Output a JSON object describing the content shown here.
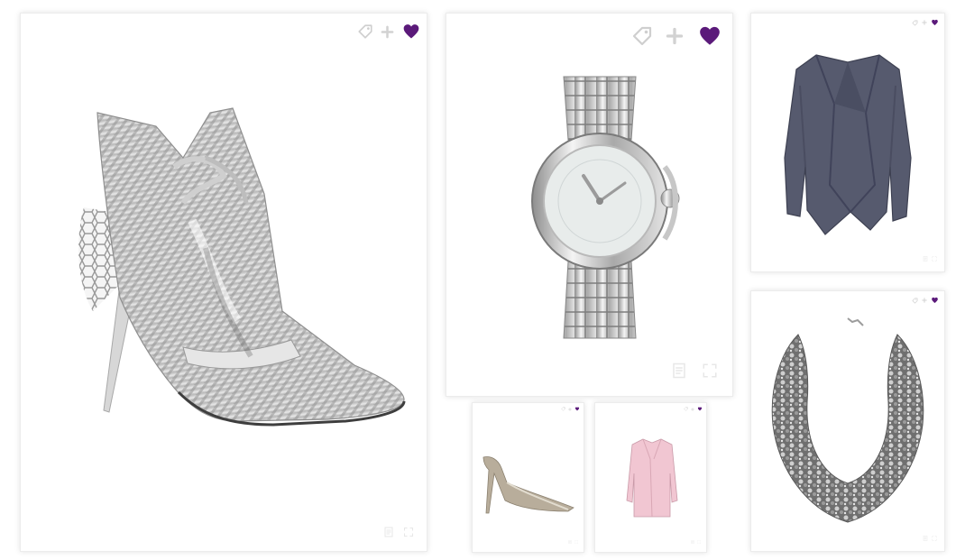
{
  "colors": {
    "accent_purple": "#5b1a7a",
    "icon_gray": "#d0d0d0",
    "card_border": "#ececec"
  },
  "icons": [
    "tag-icon",
    "plus-icon",
    "heart-icon",
    "document-icon",
    "expand-icon"
  ],
  "products": [
    {
      "id": "boot",
      "name": "silver-stiletto-ankle-boot",
      "liked": true
    },
    {
      "id": "watch",
      "name": "silver-wristwatch",
      "liked": true
    },
    {
      "id": "jacket",
      "name": "slate-draped-jacket",
      "liked": true
    },
    {
      "id": "pump",
      "name": "beige-pointed-pump",
      "liked": true
    },
    {
      "id": "coat",
      "name": "pink-coat",
      "liked": true
    },
    {
      "id": "necklace",
      "name": "chunky-chain-necklace",
      "liked": true
    }
  ]
}
